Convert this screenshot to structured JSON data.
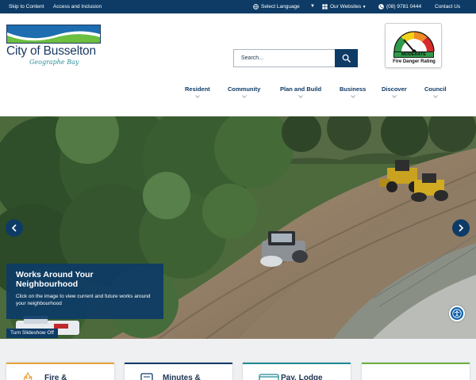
{
  "topbar": {
    "skip": "Skip to Content",
    "access": "Access and Inclusion",
    "language": "Select Language",
    "websites": "Our Websites",
    "phone": "(08) 9781 0444",
    "contact": "Contact Us"
  },
  "logo": {
    "name": "City of Busselton",
    "tagline": "Geographe Bay"
  },
  "search": {
    "placeholder": "Search..."
  },
  "fire_rating": {
    "level": "MODERATE",
    "label": "Fire Danger Rating"
  },
  "nav": {
    "items": [
      "Resident",
      "Community",
      "Plan and Build",
      "Business",
      "Discover",
      "Council"
    ]
  },
  "hero": {
    "title": "Works Around Your Neighbourhood",
    "text": "Click on the image to view current and future works around your neighbourhood",
    "slideshow_button": "Turn Slideshow Off"
  },
  "cards": {
    "items": [
      "Fire &",
      "Minutes &",
      "Pay, Lodge",
      ""
    ]
  },
  "colors": {
    "primary": "#0d3b66",
    "card_orange": "#e8a33d",
    "card_navy": "#0d3b66",
    "card_teal": "#1f8a94",
    "card_green": "#6cae3f"
  }
}
